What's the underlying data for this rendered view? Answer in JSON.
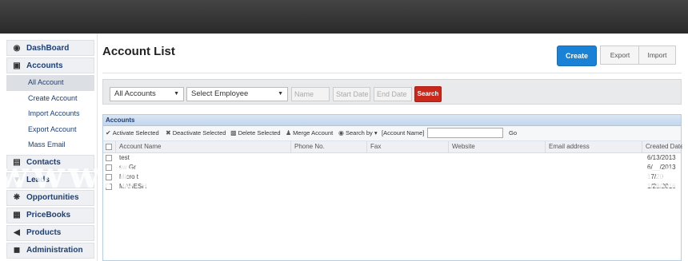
{
  "sidebar": {
    "items": [
      {
        "label": "DashBoard",
        "icon": "dashboard-icon"
      },
      {
        "label": "Accounts",
        "icon": "accounts-icon"
      },
      {
        "label": "Contacts",
        "icon": "contacts-icon"
      },
      {
        "label": "Leads",
        "icon": "leads-icon"
      },
      {
        "label": "Opportunities",
        "icon": "opportunities-icon"
      },
      {
        "label": "PriceBooks",
        "icon": "pricebooks-icon"
      },
      {
        "label": "Products",
        "icon": "products-icon"
      },
      {
        "label": "Administration",
        "icon": "lock-icon"
      }
    ],
    "accounts_sub": [
      "All Account",
      "Create Account",
      "Import Accounts",
      "Export Account",
      "Mass Email"
    ]
  },
  "header": {
    "title": "Account List",
    "create_label": "Create",
    "export_label": "Export",
    "import_label": "Import"
  },
  "filters": {
    "accounts_select": "All Accounts",
    "employee_select": "Select Employee",
    "name_placeholder": "Name",
    "start_date_placeholder": "Start Date",
    "end_date_placeholder": "End Date",
    "search_label": "Search"
  },
  "panel": {
    "title": "Accounts",
    "toolbar": {
      "activate": "Activate Selected",
      "deactivate": "Deactivate Selected",
      "delete": "Delete Selected",
      "merge": "Merge Account",
      "search_by": "Search by",
      "search_field": "[Account Name]",
      "go": "Go"
    },
    "columns": [
      "Account Name",
      "Phone No.",
      "Fax",
      "Website",
      "Email address",
      "Created Date"
    ],
    "rows": [
      {
        "name": "test",
        "created": "6/13/2013"
      },
      {
        "name": "sw Gr",
        "created": "6/__/2013"
      },
      {
        "name": "Micro t",
        "created": "17/20"
      },
      {
        "name": "MAHESH",
        "created": "1/28/2016"
      }
    ]
  },
  "watermark": "www.technologycounter.com",
  "colors": {
    "accent": "#1a82d6",
    "search": "#c9281c",
    "nav_text": "#1d3f73"
  }
}
